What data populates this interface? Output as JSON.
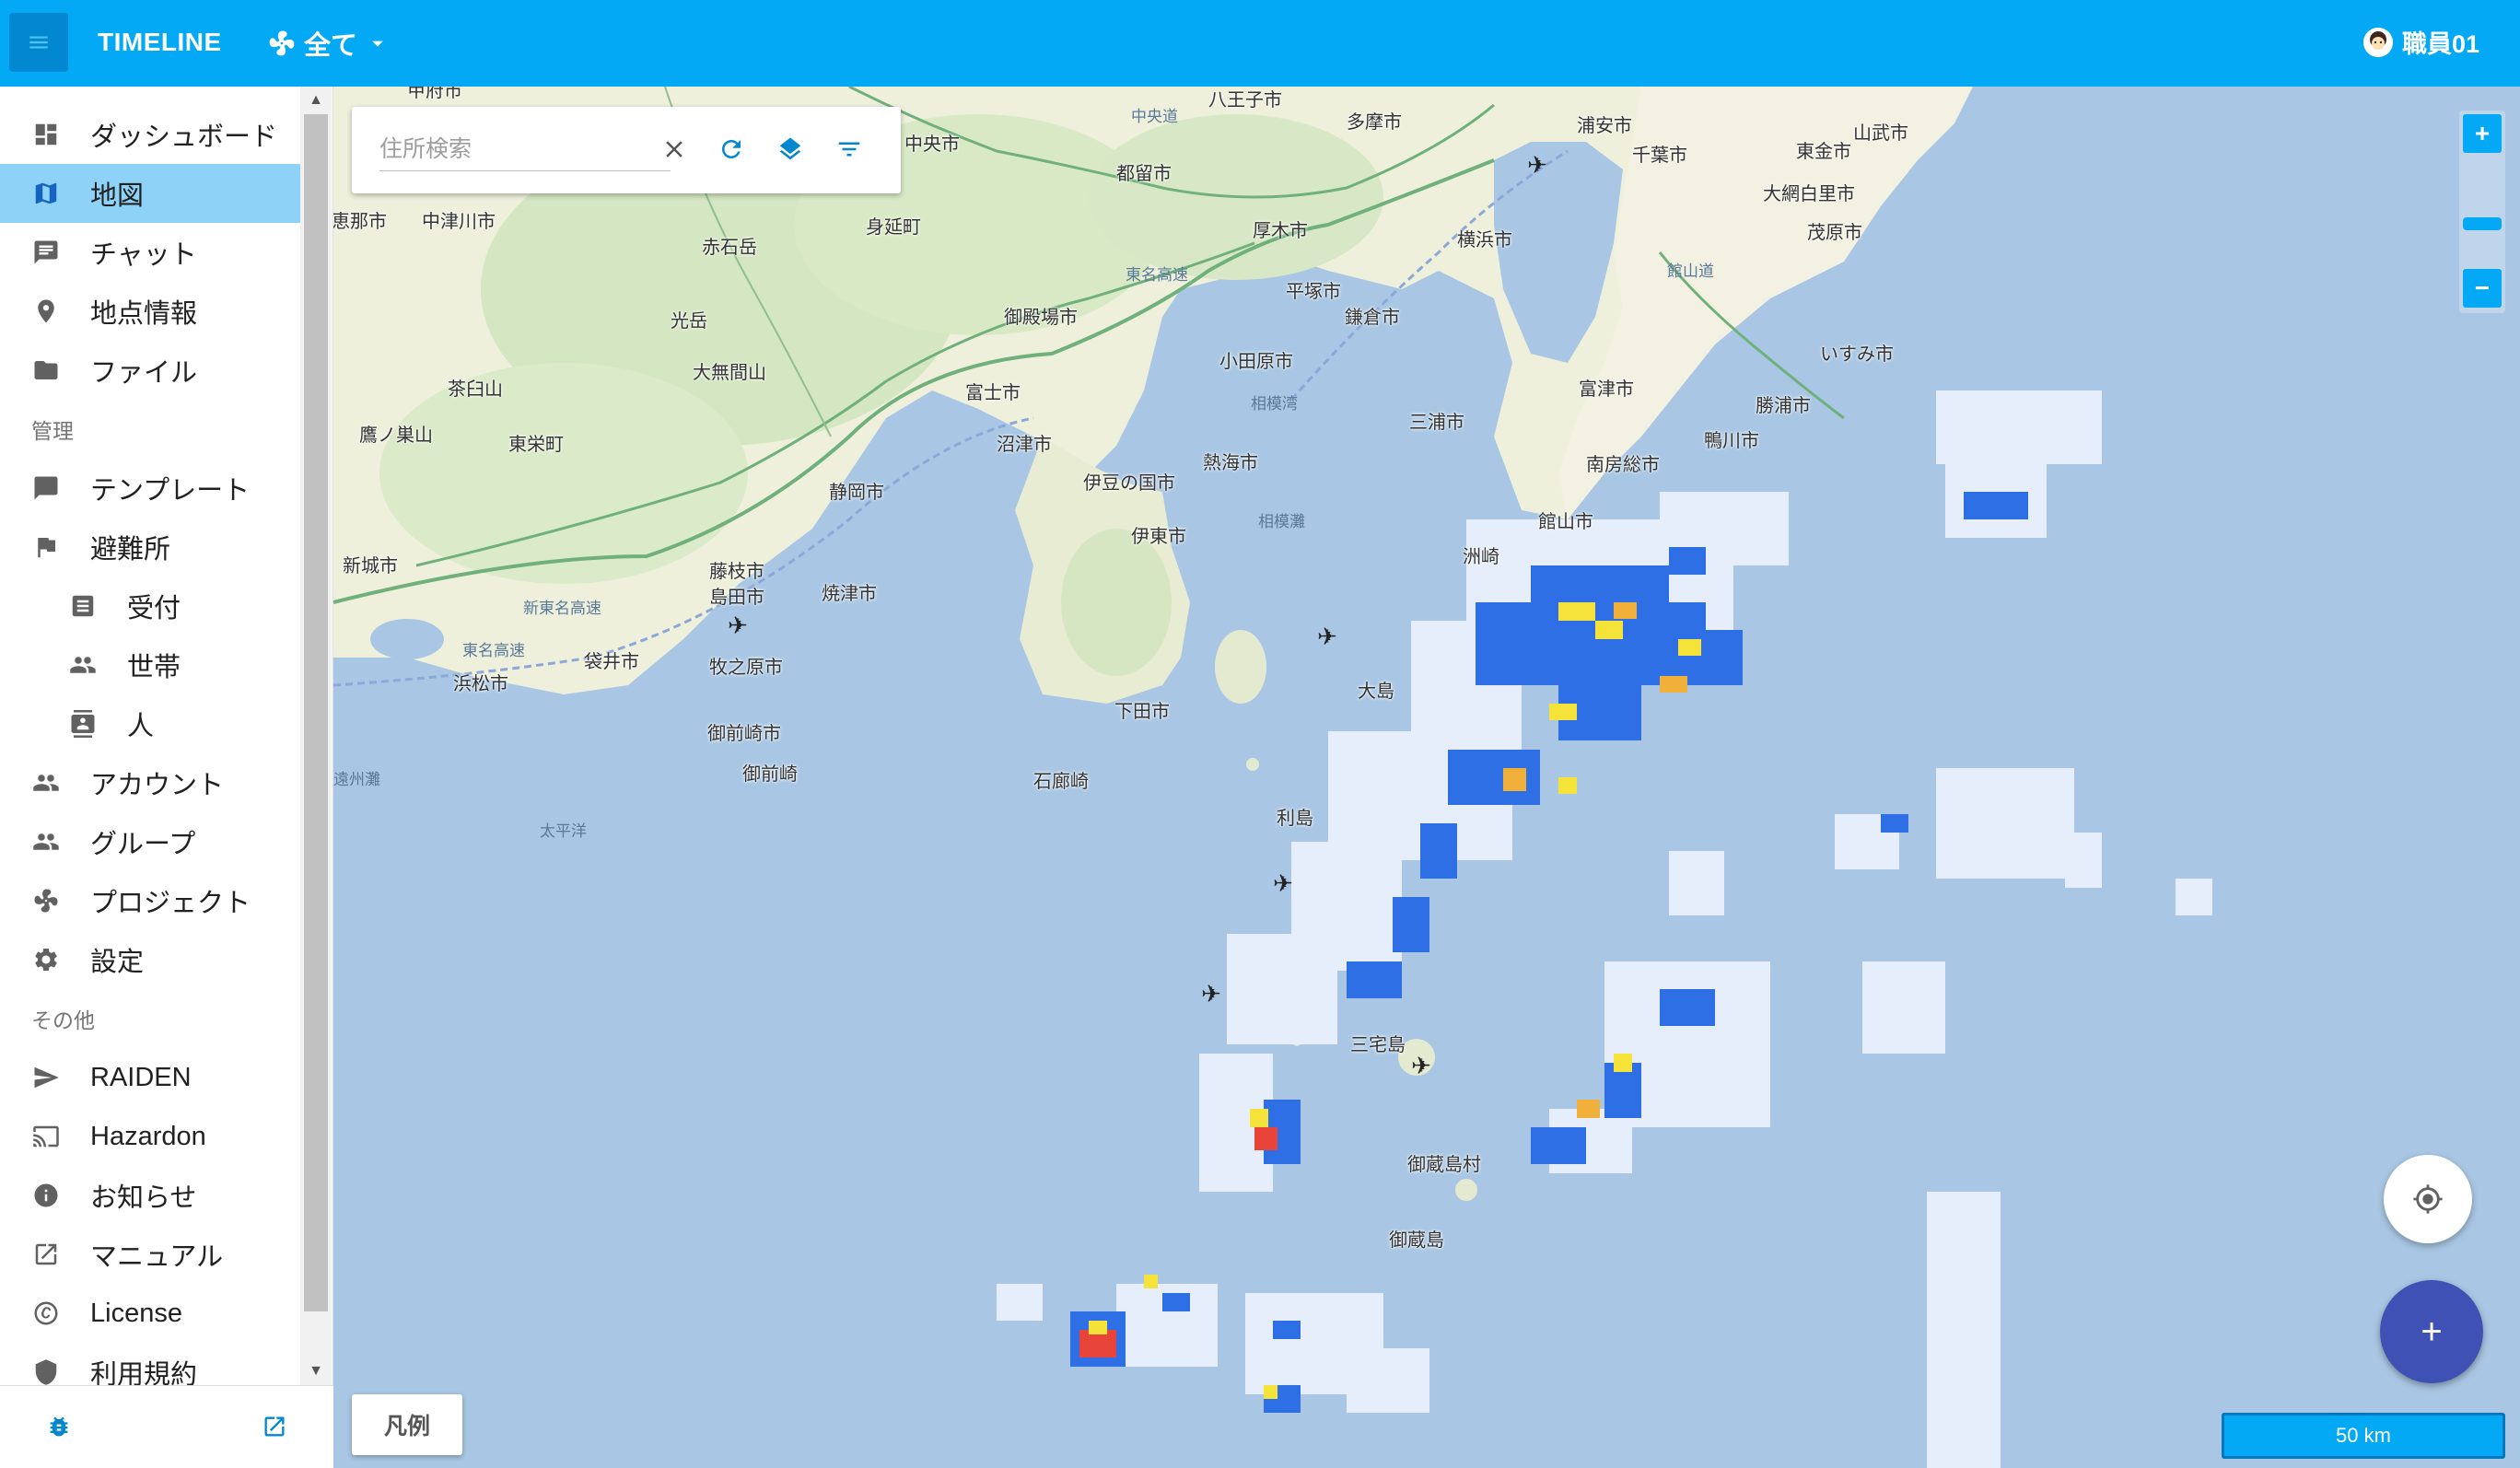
{
  "header": {
    "app_title": "TIMELINE",
    "project_label": "全て",
    "user_name": "職員01"
  },
  "sidebar": {
    "items": [
      {
        "label": "ダッシュボード",
        "icon": "dashboard-icon"
      },
      {
        "label": "地図",
        "icon": "map-icon",
        "active": true
      },
      {
        "label": "チャット",
        "icon": "chat-icon"
      },
      {
        "label": "地点情報",
        "icon": "place-icon"
      },
      {
        "label": "ファイル",
        "icon": "folder-icon"
      }
    ],
    "section_admin": "管理",
    "admin_items": [
      {
        "label": "テンプレート",
        "icon": "comment-icon"
      },
      {
        "label": "避難所",
        "icon": "flag-icon"
      },
      {
        "label": "受付",
        "icon": "list-icon",
        "sub": true
      },
      {
        "label": "世帯",
        "icon": "people-icon",
        "sub": true
      },
      {
        "label": "人",
        "icon": "contact-icon",
        "sub": true
      },
      {
        "label": "アカウント",
        "icon": "people-icon"
      },
      {
        "label": "グループ",
        "icon": "people-icon"
      },
      {
        "label": "プロジェクト",
        "icon": "fan-icon"
      },
      {
        "label": "設定",
        "icon": "gear-icon"
      }
    ],
    "section_other": "その他",
    "other_items": [
      {
        "label": "RAIDEN",
        "icon": "send-icon"
      },
      {
        "label": "Hazardon",
        "icon": "cast-icon"
      },
      {
        "label": "お知らせ",
        "icon": "info-icon"
      },
      {
        "label": "マニュアル",
        "icon": "external-link-icon"
      },
      {
        "label": "License",
        "icon": "copyright-icon"
      },
      {
        "label": "利用規約",
        "icon": "policy-icon"
      }
    ]
  },
  "search": {
    "placeholder": "住所検索",
    "value": ""
  },
  "map": {
    "labels": [
      {
        "text": "甲府市"
      },
      {
        "text": "八王子市"
      },
      {
        "text": "中央市"
      },
      {
        "text": "多摩市"
      },
      {
        "text": "浦安市"
      },
      {
        "text": "山武市"
      },
      {
        "text": "東金市"
      },
      {
        "text": "千葉市"
      },
      {
        "text": "都留市"
      },
      {
        "text": "大網白里市"
      },
      {
        "text": "茂原市"
      },
      {
        "text": "恵那市"
      },
      {
        "text": "中津川市"
      },
      {
        "text": "赤石岳"
      },
      {
        "text": "身延町"
      },
      {
        "text": "厚木市"
      },
      {
        "text": "横浜市"
      },
      {
        "text": "平塚市"
      },
      {
        "text": "御殿場市"
      },
      {
        "text": "光岳"
      },
      {
        "text": "大無間山"
      },
      {
        "text": "鎌倉市"
      },
      {
        "text": "茶臼山"
      },
      {
        "text": "小田原市"
      },
      {
        "text": "富士市"
      },
      {
        "text": "いすみ市"
      },
      {
        "text": "富津市"
      },
      {
        "text": "勝浦市"
      },
      {
        "text": "鷹ノ巣山"
      },
      {
        "text": "東栄町"
      },
      {
        "text": "三浦市"
      },
      {
        "text": "沼津市"
      },
      {
        "text": "鴨川市"
      },
      {
        "text": "熱海市"
      },
      {
        "text": "南房総市"
      },
      {
        "text": "静岡市"
      },
      {
        "text": "伊豆の国市"
      },
      {
        "text": "新城市"
      },
      {
        "text": "館山市"
      },
      {
        "text": "伊東市"
      },
      {
        "text": "藤枝市"
      },
      {
        "text": "焼津市"
      },
      {
        "text": "島田市"
      },
      {
        "text": "洲崎"
      },
      {
        "text": "袋井市"
      },
      {
        "text": "浜松市"
      },
      {
        "text": "牧之原市"
      },
      {
        "text": "大島"
      },
      {
        "text": "下田市"
      },
      {
        "text": "御前崎市"
      },
      {
        "text": "御前崎"
      },
      {
        "text": "石廊崎"
      },
      {
        "text": "利島"
      },
      {
        "text": "三宅島"
      },
      {
        "text": "御蔵島村"
      },
      {
        "text": "御蔵島"
      },
      {
        "text": "遠州灘"
      },
      {
        "text": "太平洋"
      },
      {
        "text": "相模湾"
      },
      {
        "text": "相模灘"
      },
      {
        "text": "東名高速"
      },
      {
        "text": "新東名高速"
      },
      {
        "text": "東名高速"
      },
      {
        "text": "中央道"
      },
      {
        "text": "館山道"
      }
    ]
  },
  "controls": {
    "zoom_in": "+",
    "zoom_out": "−",
    "add": "+",
    "legend": "凡例",
    "scale": "50 km"
  },
  "colors": {
    "primary": "#03a9f4",
    "primary_dark": "#0288d1",
    "active_nav": "#8ed3f7",
    "fab": "#3f51b5",
    "sea": "#a9c7e4",
    "land": "#eef0dc"
  }
}
